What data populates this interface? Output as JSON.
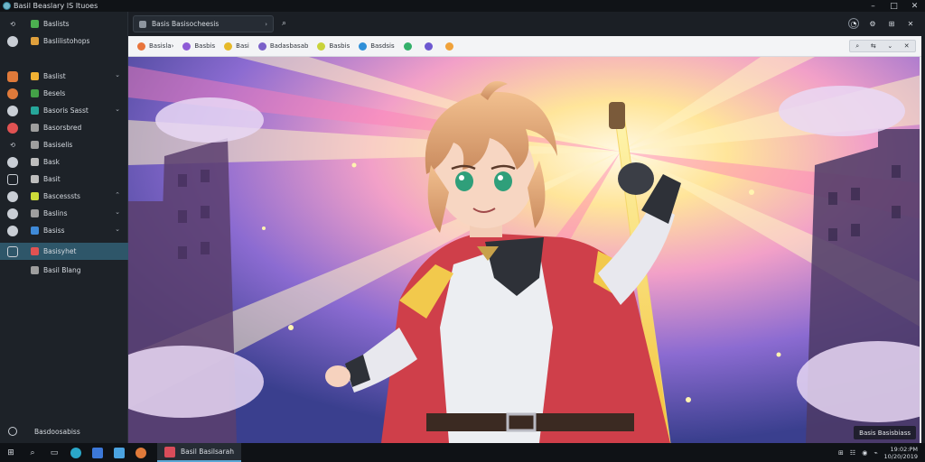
{
  "window": {
    "title": "Basil Beaslary IS Ituoes"
  },
  "sidebar": {
    "items": [
      {
        "label": "Baslists",
        "app_color": "#4caf50",
        "lead": "arrow",
        "chevron": ""
      },
      {
        "label": "Baslilistohops",
        "app_color": "#e0a03c",
        "lead": "circle",
        "chevron": ""
      },
      {
        "label": "Baslist",
        "app_color": "#f2b233",
        "lead": "square-orange",
        "chevron": "⌄"
      },
      {
        "label": "Besels",
        "app_color": "#43a047",
        "lead": "circle-orange",
        "chevron": ""
      },
      {
        "label": "Basoris Sasst",
        "app_color": "#26a69a",
        "lead": "circle",
        "chevron": "⌄"
      },
      {
        "label": "Basorsbred",
        "app_color": "#9e9e9e",
        "lead": "circle-red",
        "chevron": ""
      },
      {
        "label": "Basiselis",
        "app_color": "#9e9e9e",
        "lead": "arrow",
        "chevron": ""
      },
      {
        "label": "Bask",
        "app_color": "#bdbdbd",
        "lead": "circle",
        "chevron": ""
      },
      {
        "label": "Basit",
        "app_color": "#bdbdbd",
        "lead": "square",
        "chevron": ""
      },
      {
        "label": "Bascesssts",
        "app_color": "#cddc39",
        "lead": "circle",
        "chevron": "⌃"
      },
      {
        "label": "Baslins",
        "app_color": "#9e9e9e",
        "lead": "circle",
        "chevron": "⌄"
      },
      {
        "label": "Basiss",
        "app_color": "#3f8ad8",
        "lead": "circle",
        "chevron": "⌄"
      },
      {
        "label": "Basisyhet",
        "app_color": "#e05252",
        "lead": "square",
        "chevron": "",
        "active": true
      },
      {
        "label": "Basil Blang",
        "app_color": "#9e9e9e",
        "lead": "none",
        "chevron": ""
      }
    ],
    "footer": "Basdoosabiss"
  },
  "toolbar": {
    "address": "Basis Basisocheesis",
    "address_arrow": "›",
    "search_glyph": "⌕",
    "right_icons": [
      "◔",
      "⚙",
      "⊞",
      "✕"
    ]
  },
  "bookmarks": {
    "items": [
      {
        "label": "Basisla›",
        "color": "#e8743b"
      },
      {
        "label": "Basbis",
        "color": "#8e5bd6"
      },
      {
        "label": "Basi",
        "color": "#e6b929"
      },
      {
        "label": "Badasbasab",
        "color": "#7b61c9"
      },
      {
        "label": "Basbis",
        "color": "#c9d33a"
      },
      {
        "label": "Basdsis",
        "color": "#2f8fd8"
      },
      {
        "label": "",
        "color": "#34b06a"
      },
      {
        "label": "",
        "color": "#6d58d0"
      },
      {
        "label": "",
        "color": "#f0a23a"
      }
    ],
    "right_controls": [
      "⌕",
      "⇆",
      "⌄",
      "✕"
    ]
  },
  "content": {
    "overlay_chip": "Basis Basisbiass"
  },
  "taskbar": {
    "active_window": "Basil Basilsarah",
    "tray_icons": [
      "⊞",
      "☷",
      "◉",
      "⌁"
    ],
    "time": "19:02:PM",
    "date": "10/20/2019"
  },
  "colors": {
    "accent_active": "#2e5669",
    "sidebar_bg": "#1d2228",
    "taskbar_bg": "#0f1216"
  }
}
